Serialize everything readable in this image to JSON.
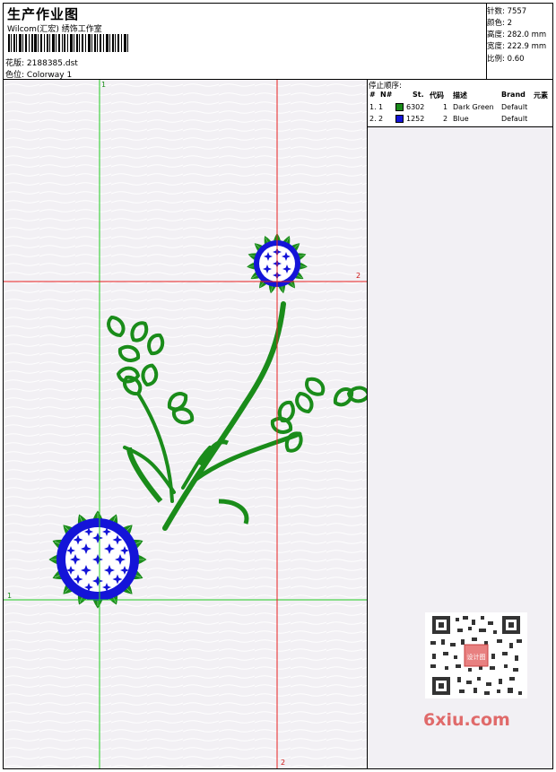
{
  "header": {
    "title": "生产作业图",
    "company": "Wilcom(汇宏) 绣饰工作室",
    "design_label": "花版:",
    "design_value": "2188385.dst",
    "colorway_label": "色位:",
    "colorway_value": "Colorway 1"
  },
  "stats": {
    "stitches_label": "针数:",
    "stitches_value": "7557",
    "colors_label": "颜色:",
    "colors_value": "2",
    "height_label": "高度:",
    "height_value": "282.0 mm",
    "width_label": "宽度:",
    "width_value": "222.9 mm",
    "scale_label": "比例:",
    "scale_value": "0.60"
  },
  "stop_sequence": {
    "title": "停止顺序:",
    "headers": [
      "#",
      "N#",
      "St.",
      "代码",
      "描述",
      "Brand",
      "元素"
    ],
    "rows": [
      {
        "num": "1.",
        "n": "1",
        "color": "#1a8c1a",
        "st": "6302",
        "code": "1",
        "desc": "Dark Green",
        "brand": "Default"
      },
      {
        "num": "2.",
        "n": "2",
        "color": "#1414d8",
        "st": "1252",
        "code": "2",
        "desc": "Blue",
        "brand": "Default"
      }
    ]
  },
  "guides": {
    "v_green_top": "1",
    "h_red_right": "2",
    "h_green_left": "1",
    "v_red_bottom": "2"
  },
  "watermark": {
    "text": "6xiu.com",
    "stamp": "设计图"
  },
  "colors": {
    "green": "#1a8c1a",
    "blue": "#1414d8",
    "guide_green": "#22cc22",
    "guide_red": "#e82020"
  }
}
